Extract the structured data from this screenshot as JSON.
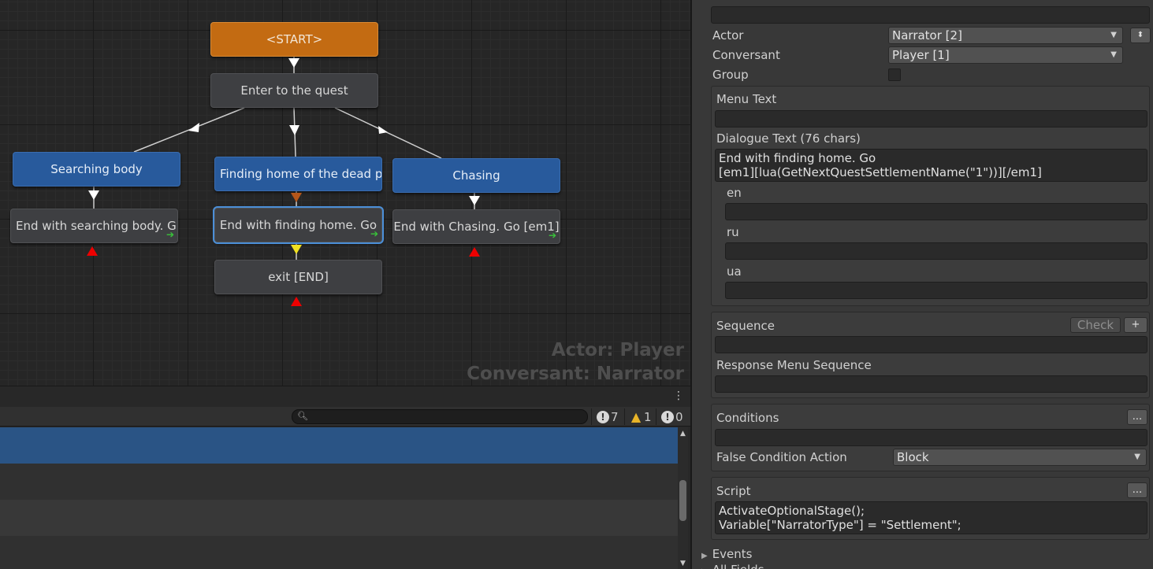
{
  "graph": {
    "nodes": {
      "start": "<START>",
      "enter": "Enter to the quest",
      "searching": "Searching body",
      "finding": "Finding home of the dead p",
      "chasing": "Chasing",
      "end_searching": "End with searching body. G",
      "end_finding": "End with finding home. Go",
      "end_chasing": "End with Chasing. Go [em1]",
      "exit": "exit [END]"
    },
    "overlay": {
      "actor": "Actor: Player",
      "conversant": "Conversant: Narrator"
    },
    "colors": {
      "orange": "#c36b12",
      "blue": "#285a9c",
      "gray": "#3e3f42"
    }
  },
  "console": {
    "search_placeholder": "",
    "info_count": "7",
    "warning_count": "1",
    "error_count": "0",
    "selected_row_color": "#2a5485"
  },
  "inspector": {
    "actor_label": "Actor",
    "actor_value": "Narrator [2]",
    "conversant_label": "Conversant",
    "conversant_value": "Player [1]",
    "group_label": "Group",
    "menu_text_label": "Menu Text",
    "menu_text_value": "",
    "dialogue_text_label": "Dialogue Text (76 chars)",
    "dialogue_text_value": "End with finding home. Go\n[em1][lua(GetNextQuestSettlementName(\"1\"))][/em1]",
    "locales": [
      {
        "code": "en",
        "value": ""
      },
      {
        "code": "ru",
        "value": ""
      },
      {
        "code": "ua",
        "value": ""
      }
    ],
    "sequence_label": "Sequence",
    "check_button": "Check",
    "plus_button": "+",
    "sequence_value": "",
    "response_menu_sequence_label": "Response Menu Sequence",
    "response_menu_sequence_value": "",
    "conditions_label": "Conditions",
    "conditions_button": "...",
    "conditions_value": "",
    "false_condition_label": "False Condition Action",
    "false_condition_value": "Block",
    "script_label": "Script",
    "script_button": "...",
    "script_value": "ActivateOptionalStage();\nVariable[\"NarratorType\"] = \"Settlement\";",
    "events_label": "Events",
    "all_fields_label": "All Fields"
  }
}
